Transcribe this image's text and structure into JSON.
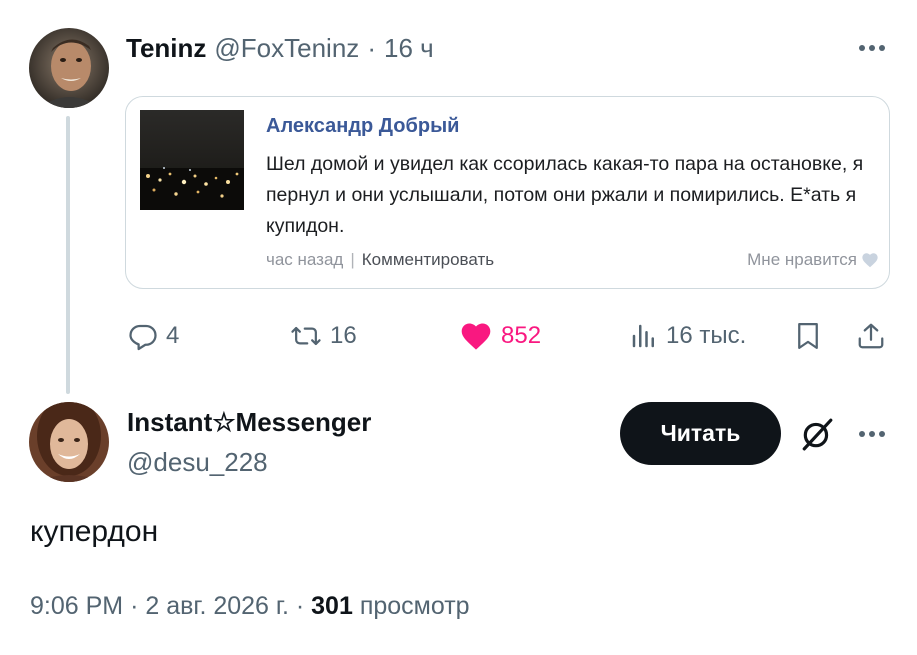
{
  "quoted_tweet": {
    "author_name": "Teninz",
    "author_handle": "@FoxTeninz",
    "separator": "·",
    "time": "16 ч",
    "embedded_post": {
      "author": "Александр Добрый",
      "text": "Шел домой и увидел как ссорилась какая-то пара на остановке, я пернул и они услышали, потом они ржали и помирились. Е*ать я купидон.",
      "time": "час назад",
      "separator": "|",
      "comment_label": "Комментировать",
      "like_label": "Мне нравится"
    },
    "actions": {
      "replies": "4",
      "retweets": "16",
      "likes": "852",
      "views": "16 тыс."
    }
  },
  "reply_tweet": {
    "author_name": "Instant☆Messenger",
    "author_handle": "@desu_228",
    "follow_label": "Читать",
    "text": "купердон",
    "time": "9:06 PM",
    "separator": "·",
    "date": "2 авг. 2026 г.",
    "views_count": "301",
    "views_label": "просмотр"
  },
  "colors": {
    "like": "#f91880",
    "muted": "#536471",
    "facebook_name": "#3b5998",
    "follow_button": "#0f1419"
  },
  "icons": [
    "reply-icon",
    "retweet-icon",
    "heart-icon",
    "views-icon",
    "bookmark-icon",
    "share-icon",
    "more-icon",
    "grok-icon"
  ]
}
